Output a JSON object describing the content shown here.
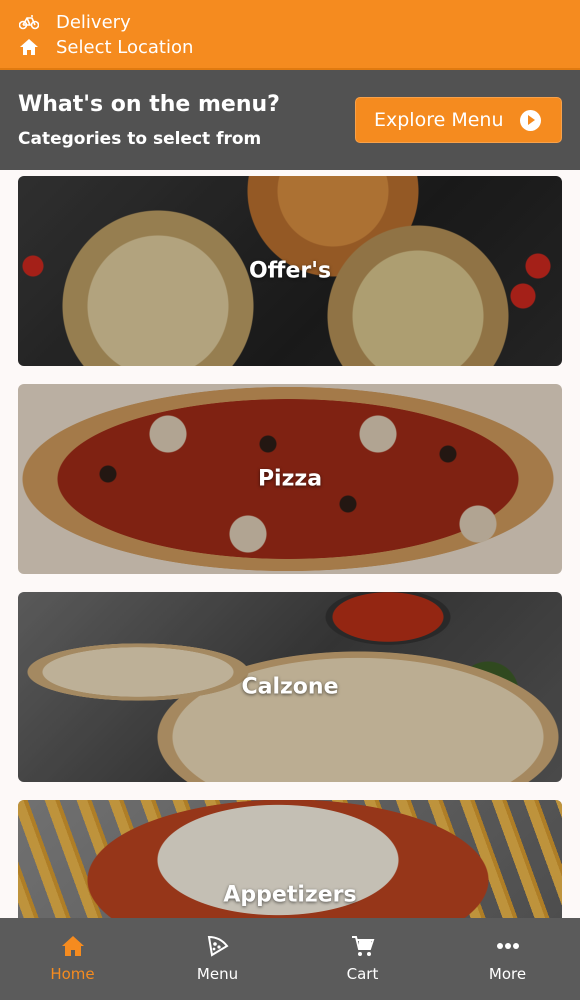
{
  "header": {
    "delivery_label": "Delivery",
    "location_label": "Select Location"
  },
  "hero": {
    "title": "What's on the menu?",
    "subtitle": "Categories to select from",
    "explore_button": "Explore Menu"
  },
  "categories": [
    {
      "label": "Offer's"
    },
    {
      "label": "Pizza"
    },
    {
      "label": "Calzone"
    },
    {
      "label": "Appetizers"
    }
  ],
  "bottom_nav": [
    {
      "label": "Home",
      "icon": "home-icon",
      "active": true
    },
    {
      "label": "Menu",
      "icon": "pizza-slice-icon",
      "active": false
    },
    {
      "label": "Cart",
      "icon": "cart-icon",
      "active": false
    },
    {
      "label": "More",
      "icon": "more-dots-icon",
      "active": false
    }
  ],
  "colors": {
    "accent": "#f58b1f",
    "hero_bg": "#525252",
    "nav_bg": "#5b5b5b"
  }
}
